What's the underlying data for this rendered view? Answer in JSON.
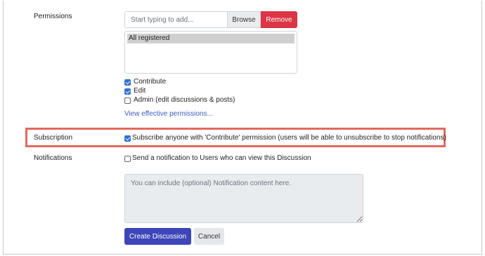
{
  "permissions": {
    "label": "Permissions",
    "input_placeholder": "Start typing to add...",
    "browse_label": "Browse",
    "remove_label": "Remove",
    "list_items": [
      "All registered"
    ],
    "checkboxes": [
      {
        "label": "Contribute",
        "checked": true
      },
      {
        "label": "Edit",
        "checked": true
      },
      {
        "label": "Admin (edit discussions & posts)",
        "checked": false
      }
    ],
    "view_link": "View effective permissions..."
  },
  "subscription": {
    "label": "Subscription",
    "checkbox_label": "Subscribe anyone with 'Contribute' permission (users will be able to unsubscribe to stop notifications)",
    "checked": true,
    "highlight_color": "#e4695d"
  },
  "notifications": {
    "label": "Notifications",
    "checkbox_label": "Send a notification to Users who can view this Discussion",
    "checked": false,
    "textarea_placeholder": "You can include (optional) Notification content here."
  },
  "actions": {
    "create_label": "Create Discussion",
    "cancel_label": "Cancel",
    "primary_color": "#3d46b8",
    "danger_color": "#dc3545"
  }
}
